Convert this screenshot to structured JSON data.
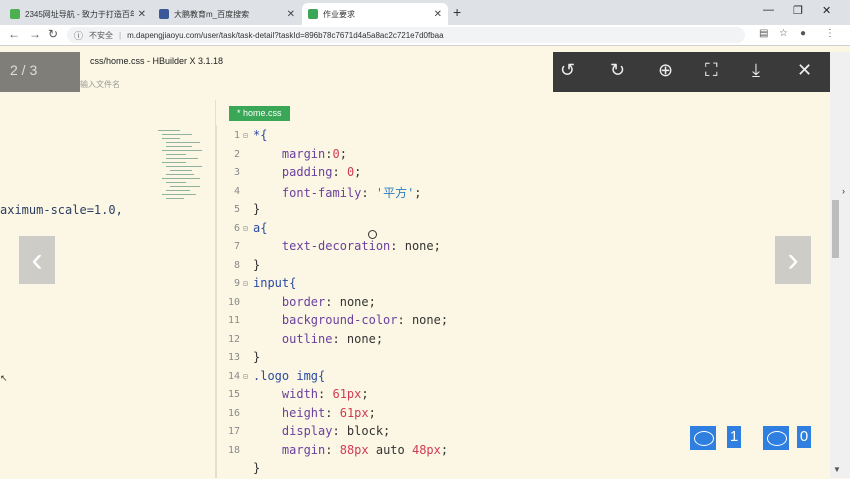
{
  "browser": {
    "tabs": [
      {
        "title": "2345网址导航 - 致力于打造百年",
        "favicon_color": "#4caf50",
        "active": false
      },
      {
        "title": "大鹏教育m_百度搜索",
        "favicon_color": "#3b5998",
        "active": false
      },
      {
        "title": "作业要求",
        "favicon_color": "#3aa757",
        "active": true
      }
    ],
    "new_tab": "+",
    "window_controls": {
      "minimize": "—",
      "restore": "❐",
      "close": "✕"
    },
    "address": {
      "security": "不安全",
      "url": "m.dapengjiaoyu.com/user/task/task-detail?taskId=896b78c7671d4a5a8ac2c721e7d0fbaa"
    }
  },
  "viewer": {
    "counter": "2 / 3",
    "hbuilder_title": "css/home.css - HBuilder X 3.1.18",
    "hbuilder_input_placeholder": "输入文件名",
    "toolbar_icons": [
      "rotate-left-icon",
      "rotate-right-icon",
      "zoom-in-icon",
      "fullscreen-icon",
      "download-icon",
      "close-icon"
    ]
  },
  "left_pane": {
    "code_fragment": "aximum-scale=1.0,"
  },
  "editor": {
    "file_tab": "* home.css",
    "lines": [
      {
        "n": "1",
        "fold": true,
        "parts": [
          [
            "sel",
            "*{"
          ]
        ]
      },
      {
        "n": "2",
        "fold": false,
        "parts": [
          [
            "plain",
            "    "
          ],
          [
            "prop",
            "margin"
          ],
          [
            "plain",
            ":"
          ],
          [
            "val",
            "0"
          ],
          [
            "plain",
            ";"
          ]
        ]
      },
      {
        "n": "3",
        "fold": false,
        "parts": [
          [
            "plain",
            "    "
          ],
          [
            "prop",
            "padding"
          ],
          [
            "plain",
            ": "
          ],
          [
            "val",
            "0"
          ],
          [
            "plain",
            ";"
          ]
        ]
      },
      {
        "n": "4",
        "fold": false,
        "parts": [
          [
            "plain",
            "    "
          ],
          [
            "prop",
            "font-family"
          ],
          [
            "plain",
            ": "
          ],
          [
            "str",
            "'平方'"
          ],
          [
            "plain",
            ";"
          ]
        ]
      },
      {
        "n": "5",
        "fold": false,
        "parts": [
          [
            "plain",
            "}"
          ]
        ]
      },
      {
        "n": "6",
        "fold": true,
        "parts": [
          [
            "sel",
            "a{"
          ]
        ]
      },
      {
        "n": "7",
        "fold": false,
        "parts": [
          [
            "plain",
            "    "
          ],
          [
            "prop",
            "text-decoration"
          ],
          [
            "plain",
            ": none;"
          ]
        ]
      },
      {
        "n": "8",
        "fold": false,
        "parts": [
          [
            "plain",
            "}"
          ]
        ]
      },
      {
        "n": "9",
        "fold": true,
        "parts": [
          [
            "sel",
            "input{"
          ]
        ]
      },
      {
        "n": "10",
        "fold": false,
        "parts": [
          [
            "plain",
            "    "
          ],
          [
            "prop",
            "border"
          ],
          [
            "plain",
            ": none;"
          ]
        ]
      },
      {
        "n": "11",
        "fold": false,
        "parts": [
          [
            "plain",
            "    "
          ],
          [
            "prop",
            "background-color"
          ],
          [
            "plain",
            ": none;"
          ]
        ]
      },
      {
        "n": "12",
        "fold": false,
        "parts": [
          [
            "plain",
            "    "
          ],
          [
            "prop",
            "outline"
          ],
          [
            "plain",
            ": none;"
          ]
        ]
      },
      {
        "n": "13",
        "fold": false,
        "parts": [
          [
            "plain",
            "}"
          ]
        ]
      },
      {
        "n": "14",
        "fold": true,
        "parts": [
          [
            "sel",
            ".logo img{"
          ]
        ]
      },
      {
        "n": "15",
        "fold": false,
        "parts": [
          [
            "plain",
            "    "
          ],
          [
            "prop",
            "width"
          ],
          [
            "plain",
            ": "
          ],
          [
            "val",
            "61px"
          ],
          [
            "plain",
            ";"
          ]
        ]
      },
      {
        "n": "16",
        "fold": false,
        "parts": [
          [
            "plain",
            "    "
          ],
          [
            "prop",
            "height"
          ],
          [
            "plain",
            ": "
          ],
          [
            "val",
            "61px"
          ],
          [
            "plain",
            ";"
          ]
        ]
      },
      {
        "n": "17",
        "fold": false,
        "parts": [
          [
            "plain",
            "    "
          ],
          [
            "prop",
            "display"
          ],
          [
            "plain",
            ": block;"
          ]
        ]
      },
      {
        "n": "18",
        "fold": false,
        "parts": [
          [
            "plain",
            "    "
          ],
          [
            "prop",
            "margin"
          ],
          [
            "plain",
            ": "
          ],
          [
            "val",
            "88px"
          ],
          [
            "plain",
            " auto "
          ],
          [
            "val",
            "48px"
          ],
          [
            "plain",
            ";"
          ]
        ]
      },
      {
        "n": "",
        "fold": false,
        "parts": [
          [
            "plain",
            "}"
          ]
        ]
      }
    ]
  },
  "stats": {
    "comments": "1",
    "likes": "0"
  },
  "nav_arrows": {
    "prev": "‹",
    "next": "›"
  }
}
